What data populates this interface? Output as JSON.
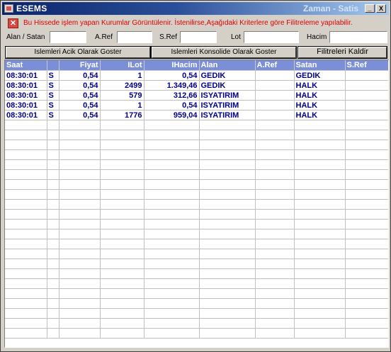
{
  "window": {
    "title": "ESEMS",
    "title_right": "Zaman - Satis",
    "minimize_label": "_",
    "close_label": "X"
  },
  "notice": {
    "icon": "close-x-icon",
    "text": "Bu Hissede işlem yapan Kurumlar Görüntülenir. İstenilirse,Aşağıdaki Kriterlere göre Filitreleme yapılabilir."
  },
  "filters": {
    "alan_satan_label": "Alan / Satan",
    "aref_label": "A.Ref",
    "sref_label": "S.Ref",
    "lot_label": "Lot",
    "hacim_label": "Hacim",
    "alan_satan_value": "",
    "aref_value": "",
    "sref_value": "",
    "lot_value": "",
    "hacim_value": ""
  },
  "buttons": {
    "acik": "Islemleri Acik Olarak Goster",
    "konsolide": "Islemleri Konsolide Olarak Goster",
    "kaldir": "Filitreleri Kaldir"
  },
  "table": {
    "headers": [
      "Saat",
      "",
      "Fiyat",
      "ILot",
      "IHacim",
      "Alan",
      "A.Ref",
      "Satan",
      "S.Ref"
    ],
    "rows": [
      [
        "08:30:01",
        "S",
        "0,54",
        "1",
        "0,54",
        "GEDIK",
        "",
        "GEDIK",
        ""
      ],
      [
        "08:30:01",
        "S",
        "0,54",
        "2499",
        "1.349,46",
        "GEDIK",
        "",
        "HALK",
        ""
      ],
      [
        "08:30:01",
        "S",
        "0,54",
        "579",
        "312,66",
        "ISYATIRIM",
        "",
        "HALK",
        ""
      ],
      [
        "08:30:01",
        "S",
        "0,54",
        "1",
        "0,54",
        "ISYATIRIM",
        "",
        "HALK",
        ""
      ],
      [
        "08:30:01",
        "S",
        "0,54",
        "1776",
        "959,04",
        "ISYATIRIM",
        "",
        "HALK",
        ""
      ]
    ]
  },
  "colors": {
    "header_bg": "#7b8fd8",
    "cell_text": "#00008b",
    "notice_text": "#e00000"
  }
}
